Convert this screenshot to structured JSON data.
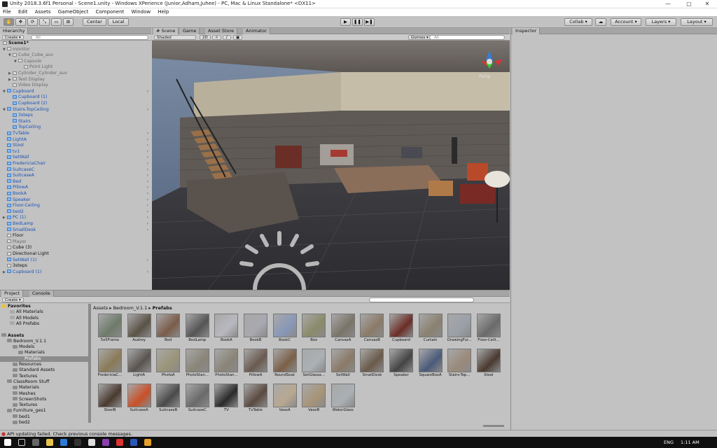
{
  "window": {
    "title": "Unity 2018.3.6f1 Personal - Scene1.unity - Windows XPerience (Junior,Adham,Juhee) - PC, Mac & Linux Standalone* <DX11>",
    "controls": [
      "—",
      "▢",
      "✕"
    ]
  },
  "menu": [
    "File",
    "Edit",
    "Assets",
    "GameObject",
    "Component",
    "Window",
    "Help"
  ],
  "toolbar": {
    "pivot": "Center",
    "space": "Local",
    "collab": "Collab ▾",
    "account": "Account ▾",
    "layers": "Layers ▾",
    "layout": "Layout ▾",
    "play": "▶",
    "pause": "❚❚",
    "step": "▶❚"
  },
  "hierarchy": {
    "tab": "Hierarchy",
    "create": "Create ▾",
    "search_placeholder": "All",
    "rows": [
      {
        "label": "Scene1*",
        "style": "scene"
      },
      {
        "label": "monitor",
        "style": "gray"
      },
      {
        "label": "Cube_Cube_auv",
        "style": "gray"
      },
      {
        "label": "Capsule",
        "style": "gray"
      },
      {
        "label": "Point Light",
        "style": "gray"
      },
      {
        "label": "Cylinder_Cylinder_auv",
        "style": "gray"
      },
      {
        "label": "Text Display",
        "style": "gray"
      },
      {
        "label": "Video Display",
        "style": "gray"
      },
      {
        "label": "Cupboard",
        "style": "blue"
      },
      {
        "label": "Cupboard (1)",
        "style": "blue"
      },
      {
        "label": "Cupboard (2)",
        "style": "blue"
      },
      {
        "label": "Stairs-TopCeiling",
        "style": "blue"
      },
      {
        "label": "3steps",
        "style": "blue"
      },
      {
        "label": "Stairs",
        "style": "blue"
      },
      {
        "label": "TopCeiling",
        "style": "blue"
      },
      {
        "label": "TvTable",
        "style": "blue"
      },
      {
        "label": "LightA",
        "style": "blue"
      },
      {
        "label": "Stool",
        "style": "blue"
      },
      {
        "label": "tv1",
        "style": "blue"
      },
      {
        "label": "SetWall",
        "style": "blue"
      },
      {
        "label": "FredericiaChair",
        "style": "blue"
      },
      {
        "label": "SuitcaseC",
        "style": "blue"
      },
      {
        "label": "SuitcaseA",
        "style": "blue"
      },
      {
        "label": "Bed",
        "style": "blue"
      },
      {
        "label": "PillowA",
        "style": "blue"
      },
      {
        "label": "BookA",
        "style": "blue"
      },
      {
        "label": "Speaker",
        "style": "blue"
      },
      {
        "label": "Floor-Ceiling",
        "style": "blue"
      },
      {
        "label": "bed2",
        "style": "blue"
      },
      {
        "label": "PC (1)",
        "style": "blue"
      },
      {
        "label": "BedLamp",
        "style": "blue"
      },
      {
        "label": "SmallDesk",
        "style": "blue"
      },
      {
        "label": "Floor",
        "style": "black"
      },
      {
        "label": "Player",
        "style": "gray"
      },
      {
        "label": "Cube (3)",
        "style": "black"
      },
      {
        "label": "Directional Light",
        "style": "black"
      },
      {
        "label": "SetWall (1)",
        "style": "blue"
      },
      {
        "label": "3steps",
        "style": "black"
      },
      {
        "label": "Cupboard (1)",
        "style": "blue"
      }
    ]
  },
  "scene": {
    "tabs": [
      "# Scene",
      "Game",
      "Asset Store",
      "Animator"
    ],
    "shading": "Shaded",
    "mode_2d": "2D",
    "gizmos": "Gizmos ▾",
    "search_placeholder": "All",
    "persp": "Persp"
  },
  "inspector": {
    "tab": "Inspector"
  },
  "project": {
    "tabs": [
      "Project",
      "Console"
    ],
    "create": "Create ▾",
    "breadcrumb": [
      "Assets",
      "Bedroom_V.1.1",
      "Prefabs"
    ],
    "tree": [
      {
        "label": "Favorites",
        "bold": true
      },
      {
        "label": "All Materials"
      },
      {
        "label": "All Models"
      },
      {
        "label": "All Prefabs"
      },
      {
        "label": ""
      },
      {
        "label": "Assets",
        "bold": true
      },
      {
        "label": "Bedroom_V.1.1"
      },
      {
        "label": "Models"
      },
      {
        "label": "Materials"
      },
      {
        "label": "Prefabs",
        "selected": true
      },
      {
        "label": "Resources"
      },
      {
        "label": "Standard Assets"
      },
      {
        "label": "Textures"
      },
      {
        "label": "ClassRoom Stuff"
      },
      {
        "label": "Materials"
      },
      {
        "label": "Meshes"
      },
      {
        "label": "ScreenShots"
      },
      {
        "label": "Textures"
      },
      {
        "label": "Furniture_ges1"
      },
      {
        "label": "bed1"
      },
      {
        "label": "bed2"
      }
    ],
    "assets": [
      "5x5Frame",
      "Audrey",
      "Bed",
      "BedLamp",
      "BookA",
      "BookB",
      "BookC",
      "Box",
      "CanvasA",
      "CanvasB",
      "Cupboard",
      "Curtain",
      "DrawingFur...",
      "Floor-Ceili...",
      "FredericiaC...",
      "LightA",
      "PhotoA",
      "PhotoStan...",
      "PhotoStan...",
      "PillowA",
      "RoundSeat",
      "SetGlassa...",
      "SetWall",
      "SmallDesk",
      "Speaker",
      "SquareBoxA",
      "Stairs-Top...",
      "Stool",
      "StoolB",
      "SuitcaseA",
      "SuitcaseB",
      "SuitcaseC",
      "TV",
      "TvTable",
      "VaseA",
      "VaseB",
      "WaterGlass"
    ]
  },
  "status": "API updating failed. Check previous console messages.",
  "taskbar": {
    "lang": "ENG",
    "time": "1:11 AM"
  },
  "colors": {
    "blue_text": "#1a52b8",
    "panel": "#c2c2c2",
    "selection": "#3d6cc0"
  }
}
